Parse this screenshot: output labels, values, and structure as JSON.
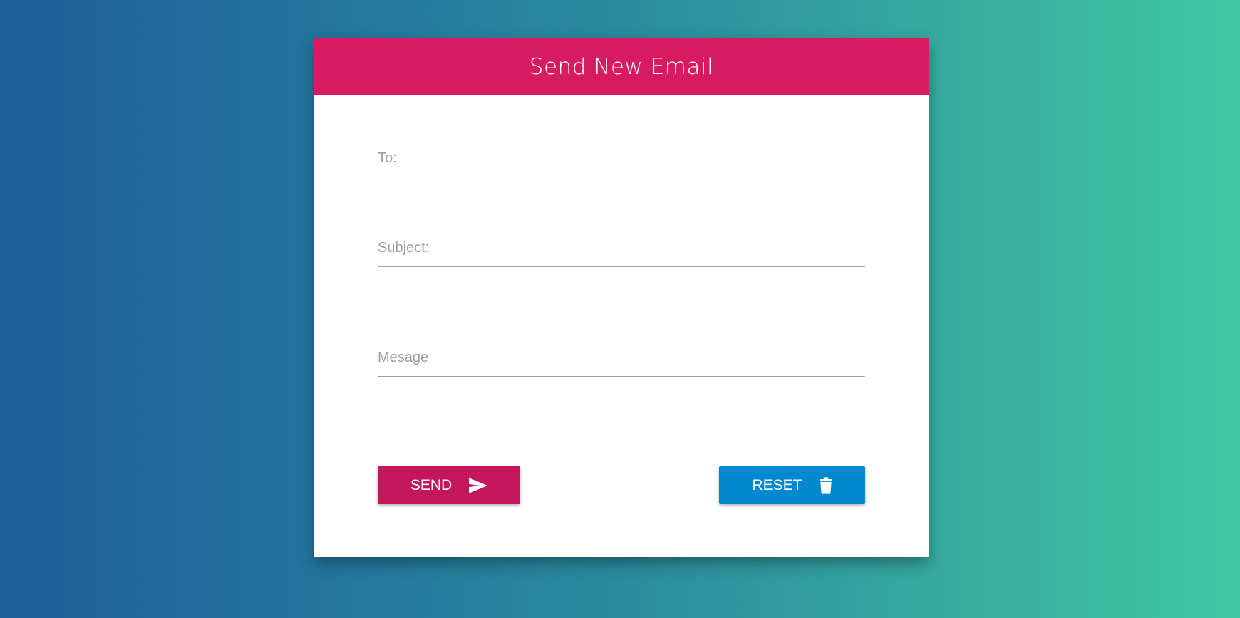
{
  "header": {
    "title": "Send New Email"
  },
  "form": {
    "to": {
      "placeholder": "To:",
      "value": ""
    },
    "subject": {
      "placeholder": "Subject:",
      "value": ""
    },
    "message": {
      "placeholder": "Mesage",
      "value": ""
    }
  },
  "buttons": {
    "send": {
      "label": "SEND",
      "icon": "send-icon"
    },
    "reset": {
      "label": "RESET",
      "icon": "trash-icon"
    }
  },
  "colors": {
    "header": "#d81b60",
    "send": "#c2185b",
    "reset": "#0288d1"
  }
}
